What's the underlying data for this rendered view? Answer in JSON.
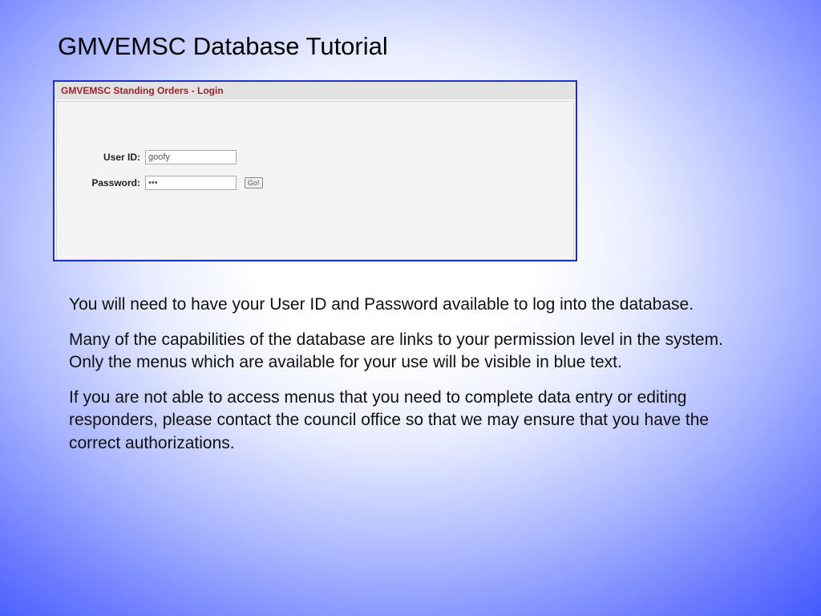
{
  "slide": {
    "title": "GMVEMSC Database Tutorial"
  },
  "login": {
    "header": "GMVEMSC Standing Orders - Login",
    "user_id_label": "User ID:",
    "user_id_value": "goofy",
    "password_label": "Password:",
    "password_value": "•••",
    "go_label": "Go!"
  },
  "body": {
    "p1": "You will need to have your User ID and Password available to log into the database.",
    "p2": "Many of the capabilities of the database are links to your permission level in the system. Only the menus which are available for your use will be visible in blue text.",
    "p3": "If you are not able to access menus that you need to complete data entry or editing responders, please contact the council office so that we may ensure that you have the correct authorizations."
  }
}
